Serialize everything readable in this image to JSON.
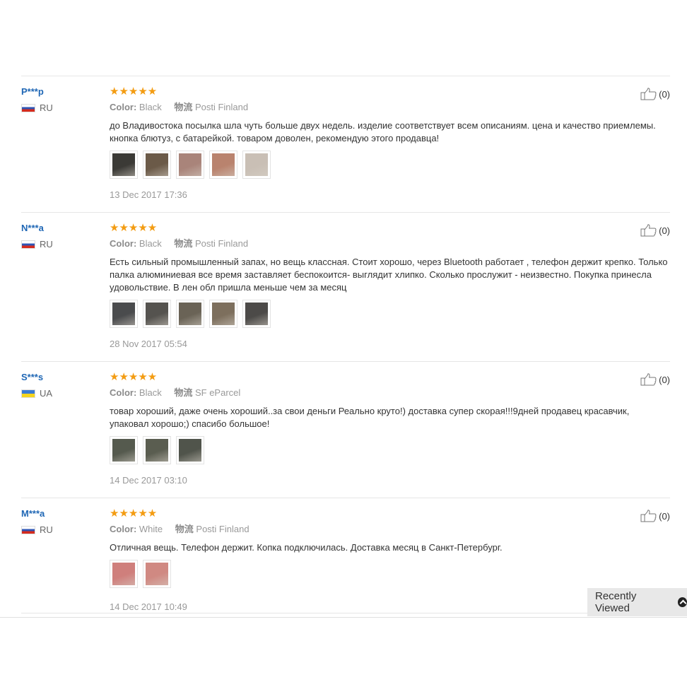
{
  "reviews": [
    {
      "user": "P***p",
      "country": "RU",
      "flag": "ru",
      "stars": "★★★★★",
      "color_label": "Color:",
      "color_value": "Black",
      "shipping_label": "物流",
      "shipping_value": "Posti Finland",
      "text": "до Владивостока посылка шла чуть больше двух недель. изделие соответствует всем описаниям. цена и качество приемлемы. кнопка блютуз, с батарейкой. товаром доволен, рекомендую этого продавца!",
      "photos": [
        "#3b3a36",
        "#6b5a48",
        "#a9847a",
        "#b9836e",
        "#c9bfb5"
      ],
      "date": "13 Dec 2017 17:36",
      "helpful": "(0)"
    },
    {
      "user": "N***a",
      "country": "RU",
      "flag": "ru",
      "stars": "★★★★★",
      "color_label": "Color:",
      "color_value": "Black",
      "shipping_label": "物流",
      "shipping_value": "Posti Finland",
      "text": "Есть сильный промышленный запах, но вещь классная. Стоит хорошо, через Bluetooth работает , телефон держит крепко. Только палка алюминиевая все время заставляет беспокоится- выглядит хлипко. Сколько прослужит - неизвестно. Покупка принесла удовольствие. В лен обл пришла меньше чем за месяц",
      "photos": [
        "#4a4b4d",
        "#55534f",
        "#6a6356",
        "#7d6f5d",
        "#4c4a48"
      ],
      "date": "28 Nov 2017 05:54",
      "helpful": "(0)"
    },
    {
      "user": "S***s",
      "country": "UA",
      "flag": "ua",
      "stars": "★★★★★",
      "color_label": "Color:",
      "color_value": "Black",
      "shipping_label": "物流",
      "shipping_value": "SF eParcel",
      "text": "товар хороший, даже очень хороший..за свои деньги Реально круто!) доставка супер скорая!!!9дней продавец красавчик, упаковал хорошо;) спасибо большое!",
      "photos": [
        "#555a4e",
        "#5a5d50",
        "#50544b"
      ],
      "date": "14 Dec 2017 03:10",
      "helpful": "(0)"
    },
    {
      "user": "M***a",
      "country": "RU",
      "flag": "ru",
      "stars": "★★★★★",
      "color_label": "Color:",
      "color_value": "White",
      "shipping_label": "物流",
      "shipping_value": "Posti Finland",
      "text": "Отличная вещь. Телефон держит. Копка подключилась. Доставка месяц в Санкт-Петербург.",
      "photos": [
        "#cf7f7c",
        "#d08982"
      ],
      "date": "14 Dec 2017 10:49",
      "helpful": "(0)"
    }
  ],
  "recently_viewed": {
    "label": "Recently Viewed",
    "icon": "chevron-up-circle-icon"
  },
  "colors": {
    "username": "#1f67b5",
    "stars": "#f39c12"
  }
}
